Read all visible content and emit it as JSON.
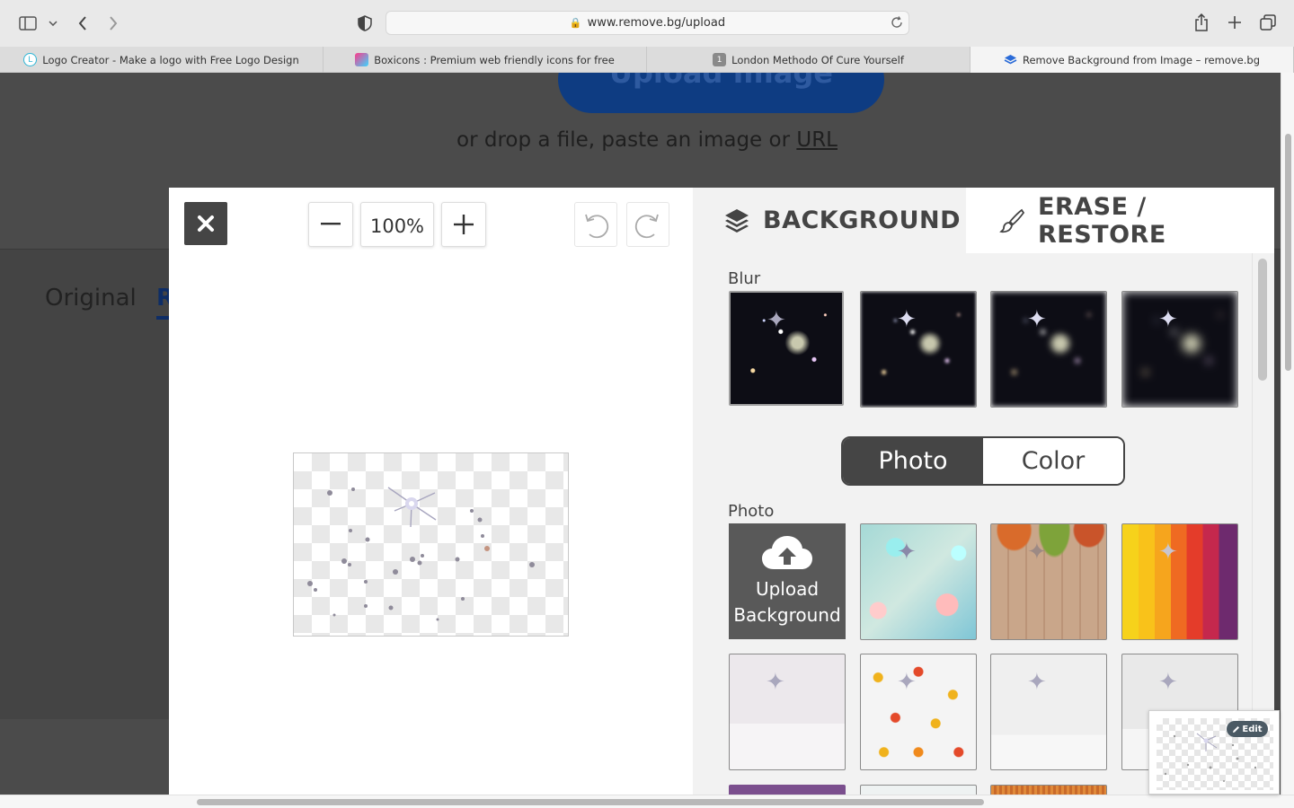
{
  "browser": {
    "url": "www.remove.bg/upload",
    "tabs": [
      {
        "label": "Logo Creator - Make a logo with Free Logo Design",
        "active": false
      },
      {
        "label": "Boxicons : Premium web friendly icons for free",
        "active": false
      },
      {
        "label": "London Methodo Of Cure Yourself",
        "active": false,
        "badge": "1"
      },
      {
        "label": "Remove Background from Image – remove.bg",
        "active": true
      }
    ]
  },
  "page": {
    "upload_button": "Upload Image",
    "drop_text_prefix": "or drop a file, paste an image or ",
    "drop_text_link": "URL",
    "tab_original": "Original",
    "tab_removed": "R"
  },
  "editor": {
    "zoom": "100%",
    "tabs": {
      "background": "BACKGROUND",
      "erase_restore": "ERASE / RESTORE"
    },
    "blur_label": "Blur",
    "photo_label": "Photo",
    "toggle": {
      "photo": "Photo",
      "color": "Color",
      "selected": "Photo"
    },
    "upload_background": {
      "line1": "Upload",
      "line2": "Background"
    },
    "edit_badge": "Edit"
  },
  "colors": {
    "accent": "#0e3c82",
    "dark_button": "#454545",
    "panel": "#f2f2f2"
  }
}
